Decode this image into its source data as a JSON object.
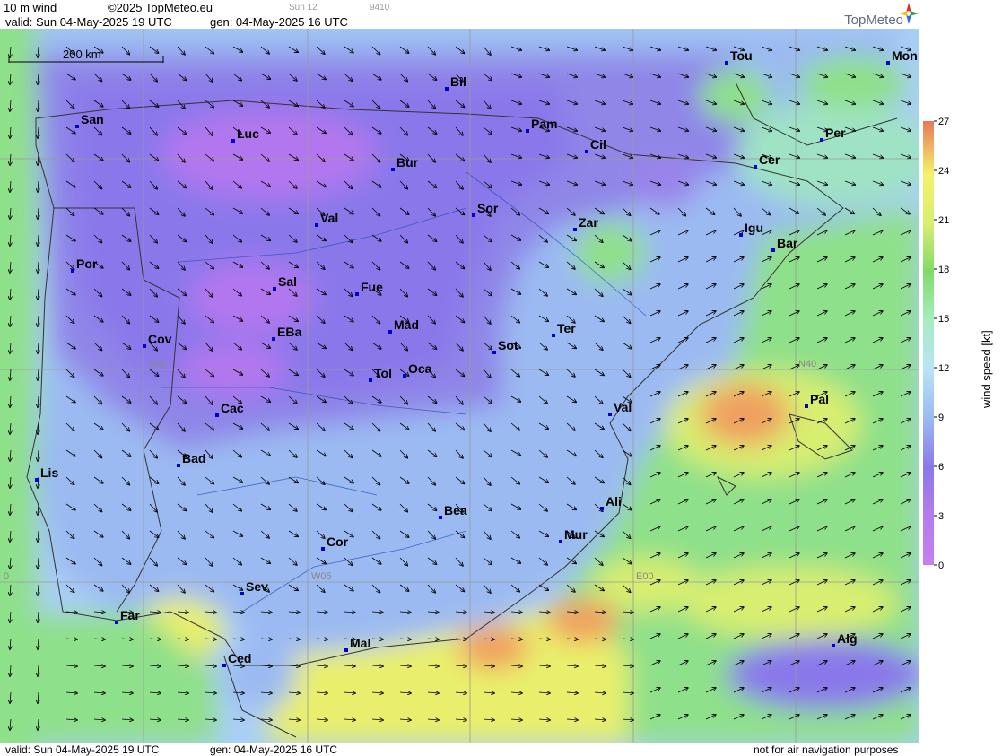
{
  "header": {
    "title": "10 m wind",
    "copyright": "©2025 TopMeteo.eu",
    "run_code": "Sun 12",
    "product_code": "9410",
    "valid": "valid:  Sun  04-May-2025  19 UTC",
    "gen": "gen: 04-May-2025 16 UTC",
    "logo": "TopMeteo"
  },
  "footer": {
    "valid": "valid:  Sun  04-May-2025  19 UTC",
    "gen": "gen: 04-May-2025 16 UTC",
    "disclaimer": "not for air navigation purposes"
  },
  "scale_bar": {
    "label": "200 km"
  },
  "legend": {
    "title": "wind speed [kt]",
    "ticks": [
      "27",
      "24",
      "21",
      "18",
      "15",
      "12",
      "9",
      "6",
      "3",
      "0"
    ]
  },
  "grid_labels": [
    "N40",
    "N40",
    "W05",
    "E00",
    "0"
  ],
  "cities": [
    "Tou",
    "Mon",
    "Bil",
    "San",
    "Luc",
    "Pam",
    "Cil",
    "Per",
    "Bur",
    "Cer",
    "Sor",
    "Val",
    "Zar",
    "Igu",
    "Bar",
    "Por",
    "Sal",
    "Fue",
    "Mad",
    "Ter",
    "Cov",
    "EBa",
    "Sot",
    "Tol",
    "Oca",
    "Pal",
    "Cac",
    "Val",
    "Bad",
    "Lis",
    "Ali",
    "Bea",
    "Mur",
    "Cor",
    "Sev",
    "Far",
    "Mal",
    "Alg",
    "Ced"
  ],
  "colors": {
    "calm_purple": "#c67ff0",
    "light_blue": "#a9cff5",
    "green": "#8fe08a",
    "yellow": "#f5f26a",
    "orange": "#f29a5a",
    "red": "#e8795a"
  }
}
